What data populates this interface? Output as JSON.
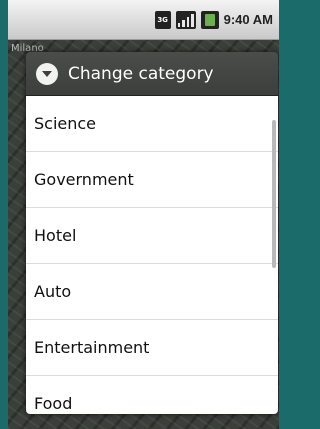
{
  "statusbar": {
    "network_icon": "3g-icon",
    "signal_icon": "signal-icon",
    "battery_icon": "battery-icon",
    "time": "9:40 AM"
  },
  "map": {
    "title": "Milano"
  },
  "dialog": {
    "title": "Change category",
    "icon": "chevron-down-circle-icon",
    "items": [
      {
        "label": "Science"
      },
      {
        "label": "Government"
      },
      {
        "label": "Hotel"
      },
      {
        "label": "Auto"
      },
      {
        "label": "Entertainment"
      },
      {
        "label": "Food"
      }
    ]
  },
  "colors": {
    "accent_bg": "#1a6b6a",
    "header_bg": "#3c3f3c",
    "list_bg": "#ffffff"
  }
}
